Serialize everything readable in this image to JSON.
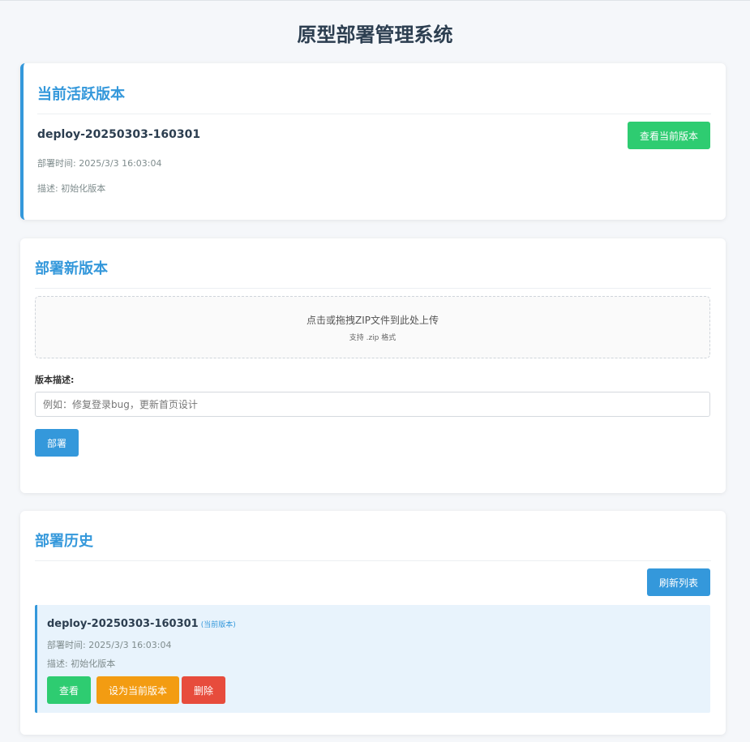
{
  "page": {
    "title": "原型部署管理系统"
  },
  "active": {
    "title": "当前活跃版本",
    "version": "deploy-20250303-160301",
    "deploy_time": "部署时间: 2025/3/3 16:03:04",
    "description": "描述: 初始化版本",
    "view_button": "查看当前版本"
  },
  "deploy": {
    "title": "部署新版本",
    "upload_main": "点击或拖拽ZIP文件到此处上传",
    "upload_hint": "支持 .zip 格式",
    "desc_label": "版本描述:",
    "desc_placeholder": "例如：修复登录bug，更新首页设计",
    "desc_value": "",
    "deploy_button": "部署"
  },
  "history": {
    "title": "部署历史",
    "refresh_button": "刷新列表",
    "items": [
      {
        "version": "deploy-20250303-160301",
        "current_tag": "(当前版本)",
        "deploy_time": "部署时间: 2025/3/3 16:03:04",
        "description": "描述: 初始化版本",
        "view_button": "查看",
        "set_current_button": "设为当前版本",
        "delete_button": "删除"
      }
    ]
  },
  "colors": {
    "accent": "#3498db",
    "success": "#2ecc71",
    "warning": "#f39c12",
    "danger": "#e74c3c"
  }
}
